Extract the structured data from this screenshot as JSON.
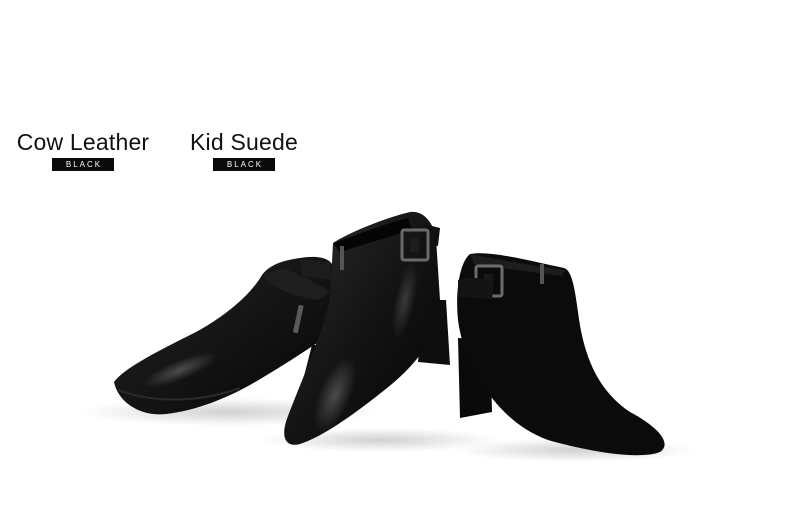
{
  "variants": [
    {
      "name": "Cow Leather",
      "color": "BLACK"
    },
    {
      "name": "Kid Suede",
      "color": "BLACK"
    }
  ],
  "colors": {
    "background": "#ffffff",
    "leather": "#141414",
    "suede": "#0b0b0b",
    "badge": "#0a0a0a"
  }
}
